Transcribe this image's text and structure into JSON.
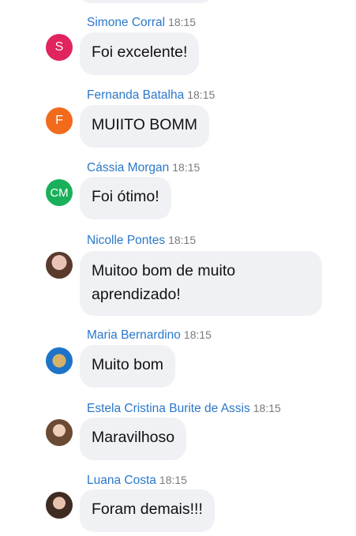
{
  "messages": [
    {
      "sender": "Simone Corral",
      "time": "18:15",
      "text": "Foi excelente!",
      "avatar": {
        "type": "initials",
        "initials": "S",
        "color": "#e0245e"
      }
    },
    {
      "sender": "Fernanda Batalha",
      "time": "18:15",
      "text": "MUIITO BOMM",
      "avatar": {
        "type": "initials",
        "initials": "F",
        "color": "#f26b1d"
      }
    },
    {
      "sender": "Cássia Morgan",
      "time": "18:15",
      "text": "Foi ótimo!",
      "avatar": {
        "type": "initials",
        "initials": "CM",
        "color": "#1ab05b"
      }
    },
    {
      "sender": "Nicolle Pontes",
      "time": "18:15",
      "text": "Muitoo bom de muito aprendizado!",
      "avatar": {
        "type": "photo",
        "icon": "profile-photo-icon"
      }
    },
    {
      "sender": "Maria Bernardino",
      "time": "18:15",
      "text": "Muito bom",
      "avatar": {
        "type": "photo",
        "icon": "profile-photo-icon"
      }
    },
    {
      "sender": "Estela Cristina Burite de Assis",
      "time": "18:15",
      "text": "Maravilhoso",
      "avatar": {
        "type": "photo",
        "icon": "profile-photo-icon"
      }
    },
    {
      "sender": "Luana Costa",
      "time": "18:15",
      "text": "Foram demais!!!",
      "avatar": {
        "type": "photo",
        "icon": "profile-photo-icon"
      }
    }
  ],
  "colors": {
    "sender_name": "#2a78c9",
    "timestamp": "#777b80",
    "bubble_bg": "#f0f1f4"
  }
}
